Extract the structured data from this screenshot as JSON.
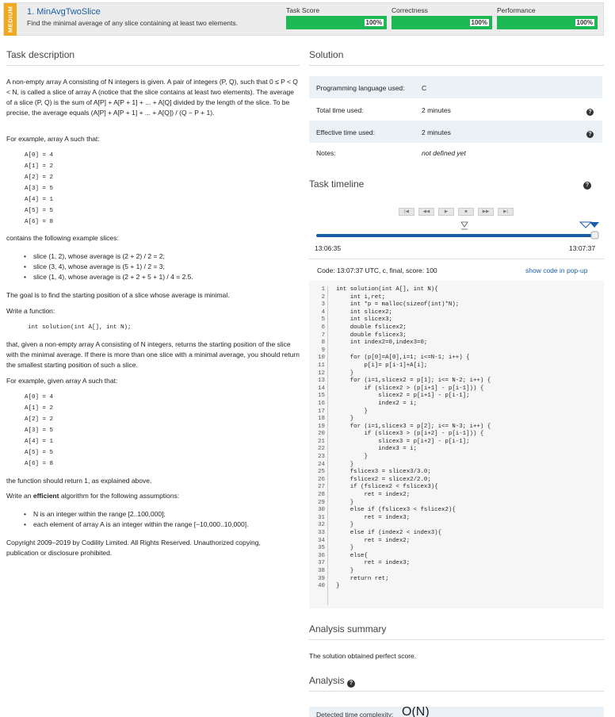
{
  "header": {
    "difficulty": "MEDIUM",
    "task_title": "1. MinAvgTwoSlice",
    "task_subtitle": "Find the minimal average of any slice containing at least two elements.",
    "scores": [
      {
        "label": "Task Score",
        "value": "100%"
      },
      {
        "label": "Correctness",
        "value": "100%"
      },
      {
        "label": "Performance",
        "value": "100%"
      }
    ]
  },
  "description": {
    "heading": "Task description",
    "p1": "A non-empty array A consisting of N integers is given. A pair of integers (P, Q), such that 0 ≤ P < Q < N, is called a slice of array A (notice that the slice contains at least two elements). The average of a slice (P, Q) is the sum of A[P] + A[P + 1] + ... + A[Q] divided by the length of the slice. To be precise, the average equals (A[P] + A[P + 1] + ... + A[Q]) / (Q − P + 1).",
    "p2": "For example, array A such that:",
    "array1": [
      "A[0] = 4",
      "A[1] = 2",
      "A[2] = 2",
      "A[3] = 5",
      "A[4] = 1",
      "A[5] = 5",
      "A[6] = 8"
    ],
    "p3": "contains the following example slices:",
    "slices": [
      "slice (1, 2), whose average is (2 + 2) / 2 = 2;",
      "slice (3, 4), whose average is (5 + 1) / 2 = 3;",
      "slice (1, 4), whose average is (2 + 2 + 5 + 1) / 4 = 2.5."
    ],
    "p4": "The goal is to find the starting position of a slice whose average is minimal.",
    "p5": "Write a function:",
    "signature": "int solution(int A[], int N);",
    "p6": "that, given a non-empty array A consisting of N integers, returns the starting position of the slice with the minimal average. If there is more than one slice with a minimal average, you should return the smallest starting position of such a slice.",
    "p7": "For example, given array A such that:",
    "array2": [
      "A[0] = 4",
      "A[1] = 2",
      "A[2] = 2",
      "A[3] = 5",
      "A[4] = 1",
      "A[5] = 5",
      "A[6] = 8"
    ],
    "p8": "the function should return 1, as explained above.",
    "p9_pre": "Write an ",
    "p9_bold": "efficient",
    "p9_post": " algorithm for the following assumptions:",
    "assumptions": [
      "N is an integer within the range [2..100,000];",
      "each element of array A is an integer within the range [−10,000..10,000]."
    ],
    "copyright": "Copyright 2009–2019 by Codility Limited. All Rights Reserved. Unauthorized copying, publication or disclosure prohibited."
  },
  "solution": {
    "heading": "Solution",
    "rows": [
      {
        "label": "Programming language used:",
        "value": "C"
      },
      {
        "label": "Total time used:",
        "value": "2 minutes"
      },
      {
        "label": "Effective time used:",
        "value": "2 minutes"
      },
      {
        "label": "Notes:",
        "value": "not defined yet"
      }
    ]
  },
  "timeline": {
    "heading": "Task timeline",
    "buttons": [
      "|◀",
      "◀◀",
      "▶",
      "■",
      "▶▶",
      "▶|"
    ],
    "start": "13:06:35",
    "end": "13:07:37",
    "code_label": "Code: 13:07:37 UTC, c, final, score:  100",
    "popup_link": "show code in pop-up"
  },
  "code": {
    "line_numbers": [
      "1",
      "2",
      "3",
      "4",
      "5",
      "6",
      "7",
      "8",
      "9",
      "10",
      "11",
      "12",
      "13",
      "14",
      "15",
      "16",
      "17",
      "18",
      "19",
      "20",
      "21",
      "22",
      "23",
      "24",
      "25",
      "26",
      "27",
      "28",
      "29",
      "30",
      "31",
      "32",
      "33",
      "34",
      "35",
      "36",
      "37",
      "38",
      "39",
      "40"
    ],
    "text": "int solution(int A[], int N){\n    int i,ret;\n    int *p = malloc(sizeof(int)*N);\n    int slicex2;\n    int slicex3;\n    double fslicex2;\n    double fslicex3;\n    int index2=0,index3=0;\n\n    for (p[0]=A[0],i=1; i<=N-1; i++) {\n        p[i]= p[i-1]+A[i];\n    }\n    for (i=1,slicex2 = p[1]; i<= N-2; i++) {\n        if (slicex2 > (p[i+1] - p[i-1])) {\n            slicex2 = p[i+1] - p[i-1];\n            index2 = i;\n        }\n    }\n    for (i=1,slicex3 = p[2]; i<= N-3; i++) {\n        if (slicex3 > (p[i+2] - p[i-1])) {\n            slicex3 = p[i+2] - p[i-1];\n            index3 = i;\n        }\n    }\n    fslicex3 = slicex3/3.0;\n    fslicex2 = slicex2/2.0;\n    if (fslicex2 < fslicex3){\n        ret = index2;\n    }\n    else if (fslicex3 < fslicex2){\n        ret = index3;\n    }\n    else if (index2 < index3){\n        ret = index2;\n    }\n    else{\n        ret = index3;\n    }\n    return ret;\n}"
  },
  "analysis": {
    "summary_heading": "Analysis summary",
    "summary_text": "The solution obtained perfect score.",
    "heading": "Analysis",
    "complexity_label": "Detected time complexity:",
    "complexity_value": "O(N)"
  }
}
